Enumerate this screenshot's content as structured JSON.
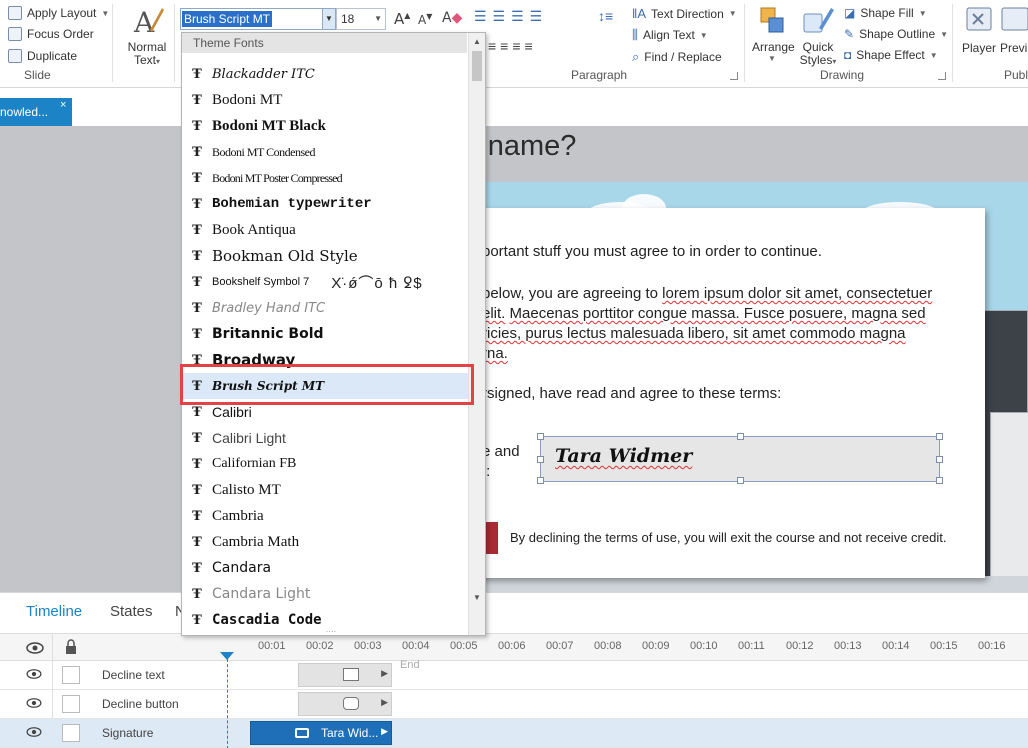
{
  "ribbon": {
    "slide_group": {
      "apply_layout": "Apply Layout",
      "focus_order": "Focus Order",
      "duplicate": "Duplicate",
      "label": "Slide"
    },
    "normal_text": {
      "line1": "Normal",
      "line2": "Text"
    },
    "font_name": "Brush Script MT",
    "font_size": "18",
    "paragraph": {
      "text_direction": "Text Direction",
      "align_text": "Align Text",
      "find_replace": "Find / Replace",
      "label": "Paragraph"
    },
    "drawing": {
      "arrange": "Arrange",
      "quick_styles_1": "Quick",
      "quick_styles_2": "Styles",
      "shape_fill": "Shape Fill",
      "shape_outline": "Shape Outline",
      "shape_effect": "Shape Effect",
      "label": "Drawing"
    },
    "publish": {
      "player": "Player",
      "preview": "Previ",
      "label": "Publ"
    }
  },
  "document_tab": {
    "label": "nowled...",
    "close": "×"
  },
  "font_dropdown": {
    "header": "Theme Fonts",
    "fonts": [
      {
        "name": "Blackadder ITC"
      },
      {
        "name": "Bodoni MT"
      },
      {
        "name": "Bodoni MT Black"
      },
      {
        "name": "Bodoni MT Condensed"
      },
      {
        "name": "Bodoni MT Poster Compressed"
      },
      {
        "name": "Bohemian typewriter"
      },
      {
        "name": "Book Antiqua"
      },
      {
        "name": "Bookman Old Style"
      },
      {
        "name": "Bookshelf Symbol 7",
        "symbols": "Χ̈·ǿ⌒ō ħ ꝿ$"
      },
      {
        "name": "Bradley Hand ITC"
      },
      {
        "name": "Britannic Bold"
      },
      {
        "name": "Broadway"
      },
      {
        "name": "Brush Script MT"
      },
      {
        "name": "Calibri"
      },
      {
        "name": "Calibri Light"
      },
      {
        "name": "Californian FB"
      },
      {
        "name": "Calisto MT"
      },
      {
        "name": "Cambria"
      },
      {
        "name": "Cambria Math"
      },
      {
        "name": "Candara"
      },
      {
        "name": "Candara Light"
      },
      {
        "name": "Cascadia Code"
      }
    ],
    "selected": "Brush Script MT"
  },
  "slide": {
    "title": "r name?",
    "line1": "portant stuff you must agree to in order to continue.",
    "para_1": "below, you are agreeing to",
    "para_1b": "lorem ipsum dolor sit amet, consectetuer",
    "para_2a": "elit.",
    "para_2b": "Maecenas porttitor congue massa. Fusce posuere, magna sed",
    "para_3a": "ricies, purus lectus malesuada libero, sit amet commodo magna",
    "para_4": "rna.",
    "agree_line": "rsigned, have read and agree to these terms:",
    "name_label_1": "e and",
    "name_label_2": "t:",
    "signature": "Tara Widmer",
    "decline_text": "By declining the terms of use, you will exit the course and not receive credit."
  },
  "timeline": {
    "tabs": [
      "Timeline",
      "States",
      "N"
    ],
    "ticks": [
      "00:01",
      "00:02",
      "00:03",
      "00:04",
      "00:05",
      "00:06",
      "00:07",
      "00:08",
      "00:09",
      "00:10",
      "00:11",
      "00:12",
      "00:13",
      "00:14",
      "00:15",
      "00:16"
    ],
    "end_label": "End",
    "rows": [
      {
        "name": "Decline text"
      },
      {
        "name": "Decline button"
      },
      {
        "name": "Signature",
        "bar_label": "Tara Wid..."
      }
    ]
  }
}
